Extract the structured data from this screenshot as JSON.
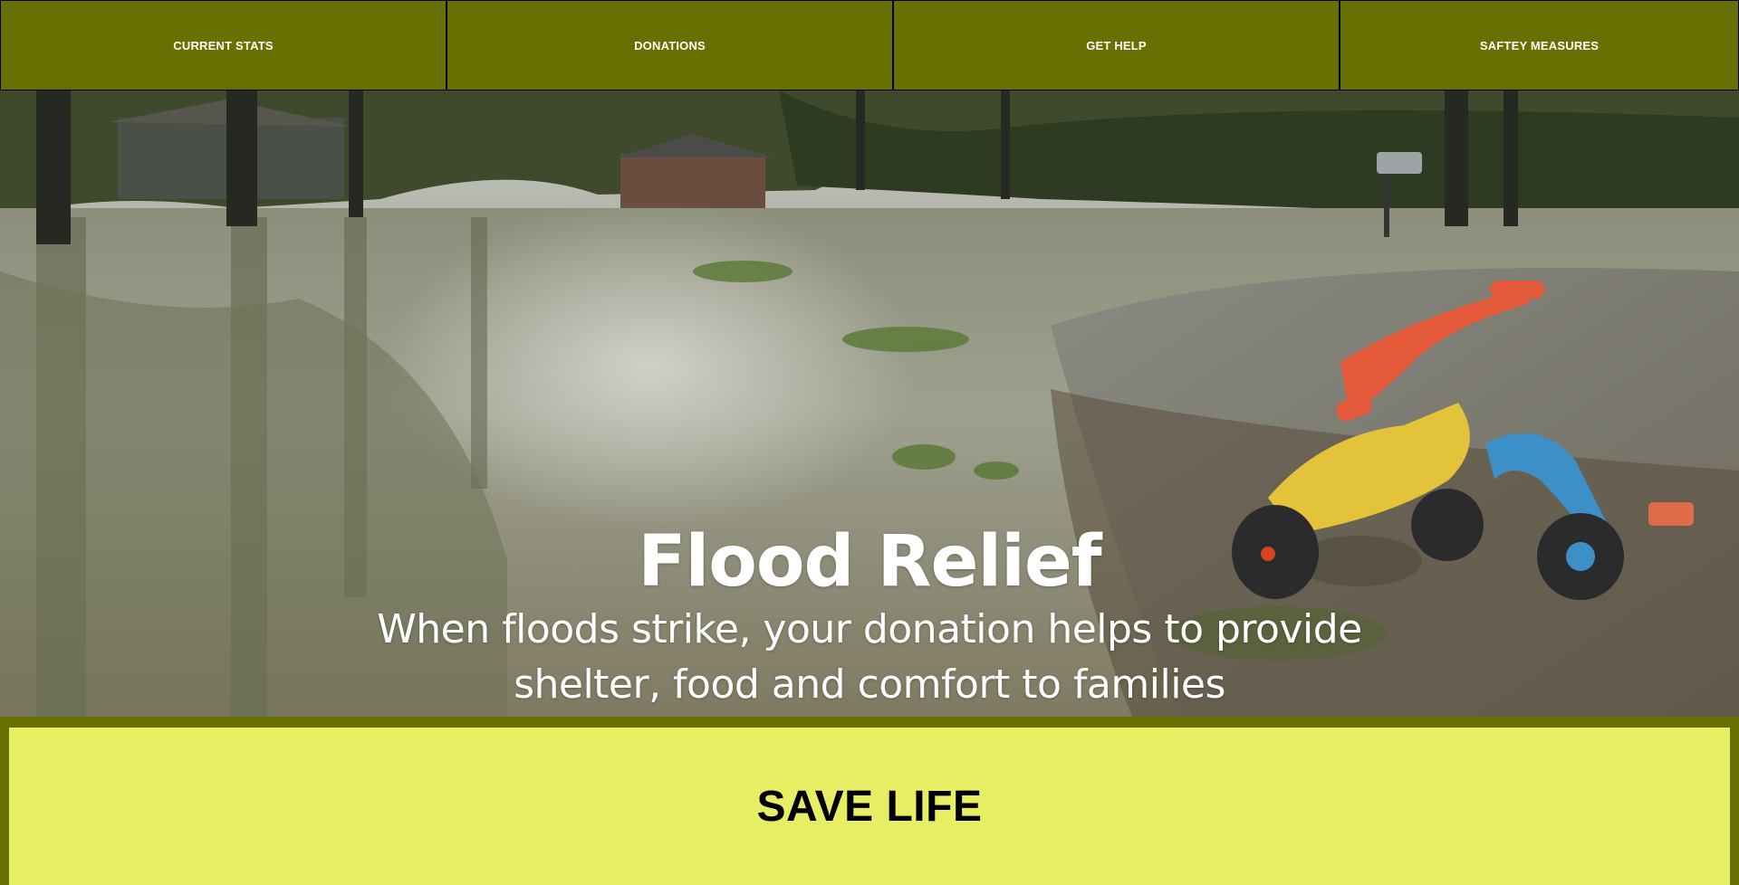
{
  "nav": {
    "items": [
      {
        "label": "CURRENT STATS"
      },
      {
        "label": "DONATIONS"
      },
      {
        "label": "GET HELP"
      },
      {
        "label": "SAFTEY MEASURES"
      }
    ]
  },
  "hero": {
    "title": "Flood Relief",
    "subtitle": "When floods strike, your donation helps to provide shelter, food and comfort to families",
    "image": "flooded-street-with-abandoned-tricycle"
  },
  "cta": {
    "title": "SAVE LIFE"
  },
  "colors": {
    "nav_bg": "#677000",
    "cta_bg": "#e8ee63",
    "text_light": "#ffffff",
    "text_dark": "#000000"
  }
}
